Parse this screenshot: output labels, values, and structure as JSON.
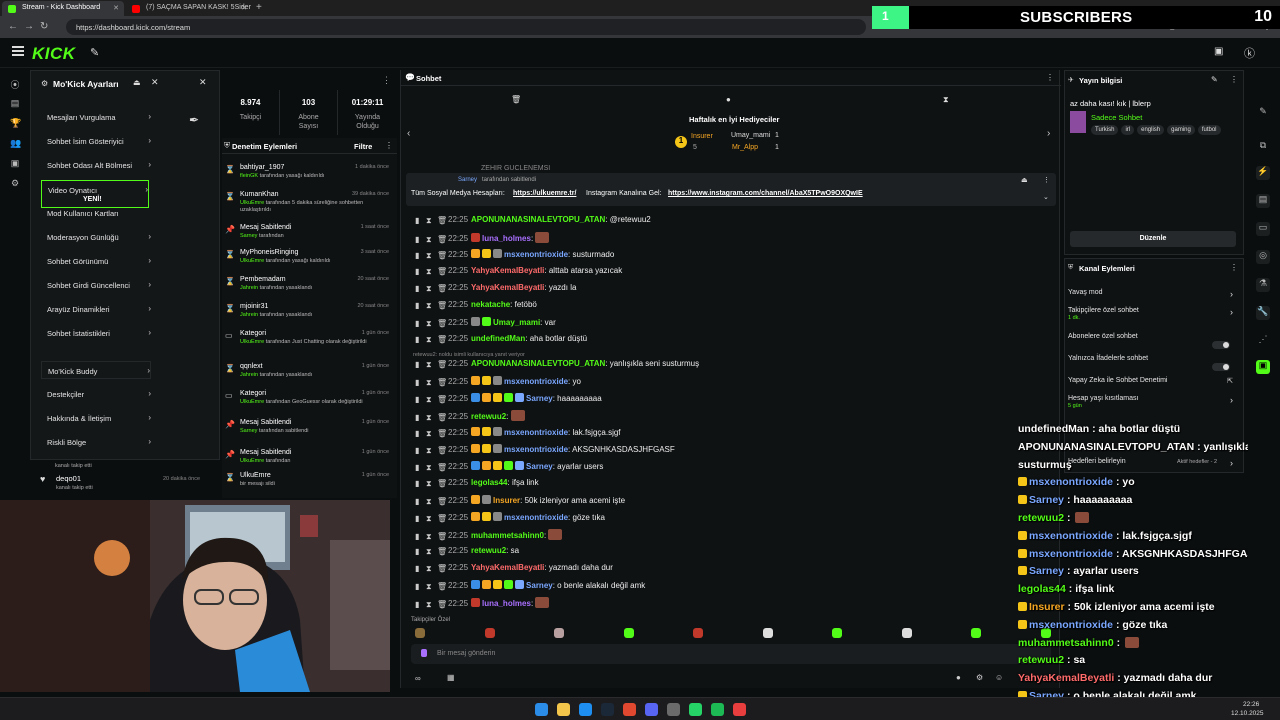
{
  "browser": {
    "tabs": [
      {
        "label": "Stream - Kick Dashboard",
        "active": true
      },
      {
        "label": "(7) SAÇMA SAPAN KASK! 5Sider",
        "active": false
      }
    ],
    "url": "https://dashboard.kick.com/stream"
  },
  "overlay_subs": {
    "value": "1",
    "title": "SUBSCRIBERS",
    "count": "10"
  },
  "kick": {
    "logo": "KICK"
  },
  "settings": {
    "title": "Mo'Kick Ayarları",
    "items": [
      {
        "label": "Mesajları Vurgulama"
      },
      {
        "label": "Sohbet İsim Gösteriyici"
      },
      {
        "label": "Sohbet Odası Alt Bölmesi"
      },
      {
        "label": "Video Oynatıcı"
      },
      {
        "label": "Mod Kullanıcı Kartları"
      },
      {
        "label": "Moderasyon Günlüğü"
      },
      {
        "label": "Sohbet Görünümü"
      },
      {
        "label": "Sohbet Girdi Güncellenci"
      },
      {
        "label": "Arayüz Dinamikleri"
      },
      {
        "label": "Sohbet İstatistikleri"
      },
      {
        "label": "Mo'Kick Buddy"
      },
      {
        "label": "Destekçiler"
      },
      {
        "label": "Hakkında & İletişim"
      },
      {
        "label": "Riskli Bölge"
      }
    ],
    "new_badge": "YENİ!"
  },
  "stats": [
    {
      "value": "8.974",
      "label": "Takipçi"
    },
    {
      "value": "103",
      "label": "Abone Sayısı"
    },
    {
      "value": "01:29:11",
      "label": "Yayında Olduğu"
    }
  ],
  "modlog": {
    "title": "Denetim Eylemleri",
    "filter": "Filtre",
    "entries": [
      {
        "name": "bahtiyar_1907",
        "time": "1 dakika önce",
        "desc1": "fleinGK",
        "desc2": "tarafından yasağı kaldırıldı"
      },
      {
        "name": "KumanKhan",
        "time": "39 dakika önce",
        "desc1": "UlkuEmre",
        "desc2": "tarafından 5 dakika süreliğine sohbetten uzaklaştırıldı"
      },
      {
        "name": "Mesaj Sabitlendi",
        "time": "1 saat önce",
        "desc1": "Sarney",
        "desc2": "tarafından"
      },
      {
        "name": "MyPhoneisRinging",
        "time": "3 saat önce",
        "desc1": "UlkuEmre",
        "desc2": "tarafından yasağı kaldırıldı"
      },
      {
        "name": "Pembemadam",
        "time": "20 saat önce",
        "desc1": "Jahrein",
        "desc2": "tarafından yasaklandı"
      },
      {
        "name": "mjoinir31",
        "time": "20 saat önce",
        "desc1": "Jahrein",
        "desc2": "tarafından yasaklandı"
      },
      {
        "name": "Kategori",
        "time": "1 gün önce",
        "desc1": "UlkuEmre",
        "desc2": "tarafından Just Chatting olarak değiştirildi"
      },
      {
        "name": "qqnlext",
        "time": "1 gün önce",
        "desc1": "Jahrein",
        "desc2": "tarafından yasaklandı"
      },
      {
        "name": "Kategori",
        "time": "1 gün önce",
        "desc1": "UlkuEmre",
        "desc2": "tarafından GeoGuessr olarak değiştirildi"
      },
      {
        "name": "Mesaj Sabitlendi",
        "time": "1 gün önce",
        "desc1": "Sarney",
        "desc2": "tarafından sabitlendi"
      },
      {
        "name": "Mesaj Sabitlendi",
        "time": "1 gün önce",
        "desc1": "UlkuEmre",
        "desc2": "tarafından"
      },
      {
        "name": "UlkuEmre",
        "time": "1 gün önce",
        "desc1": "",
        "desc2": "bir mesajı sildi"
      }
    ],
    "followers": [
      {
        "name": "deqo01",
        "time": "20 dakika önce",
        "desc": "kanalı takip etti"
      }
    ],
    "follow_prev": "kanalı takip etti",
    "ghost": "dakika önce"
  },
  "chat": {
    "title": "Sohbet",
    "gifters_title": "Haftalık en İyi Hediyeciler",
    "gifters": [
      {
        "name": "Insurer",
        "count": "5"
      },
      {
        "name": "Umay_mami",
        "count": "1"
      },
      {
        "name": "Mr_Alpp",
        "count": "1"
      }
    ],
    "pinned_by": "Sarney",
    "pinned_by_suffix": "tarafından sabitlendi",
    "pinned_text": "Tüm Sosyal Medya Hesapları:",
    "pinned_link1": "https://ulkuemre.tr/",
    "pinned_mid": "Instagram Kanalına Gel:",
    "pinned_link2": "https://www.instagram.com/channel/AbaX5TPwO9OXQwIE",
    "cut_line": "ZEHIR GUCLENEMSI",
    "reply_hint": "retewuu2: noldu isimli kullanıcıya yanıt veriyor",
    "messages": [
      {
        "time": "22:25",
        "user": "APONUNANASINALEVTOPU_ATAN",
        "color": "#53fc18",
        "msg": "@retewuu2"
      },
      {
        "time": "22:25",
        "user": "luna_holmes",
        "color": "#a970ff",
        "msg": ""
      },
      {
        "time": "22:25",
        "user": "msxenontrioxide",
        "color": "#7aa7ff",
        "msg": "susturmado"
      },
      {
        "time": "22:25",
        "user": "YahyaKemalBeyatli",
        "color": "#ff6b6b",
        "msg": "alttab atarsa yazıcak"
      },
      {
        "time": "22:25",
        "user": "YahyaKemalBeyatli",
        "color": "#ff6b6b",
        "msg": "yazdı la"
      },
      {
        "time": "22:25",
        "user": "nekatache",
        "color": "#53fc18",
        "msg": "fetöbö"
      },
      {
        "time": "22:25",
        "user": "Umay_mami",
        "color": "#53fc18",
        "msg": "var"
      },
      {
        "time": "22:25",
        "user": "undefinedMan",
        "color": "#53fc18",
        "msg": "aha botlar düştü"
      },
      {
        "time": "22:25",
        "user": "APONUNANASINALEVTOPU_ATAN",
        "color": "#53fc18",
        "msg": "yanlışıkla seni susturmuş"
      },
      {
        "time": "22:25",
        "user": "msxenontrioxide",
        "color": "#7aa7ff",
        "msg": "yo"
      },
      {
        "time": "22:25",
        "user": "Sarney",
        "color": "#7aa7ff",
        "msg": "haaaaaaaaa"
      },
      {
        "time": "22:25",
        "user": "retewuu2",
        "color": "#53fc18",
        "msg": ""
      },
      {
        "time": "22:25",
        "user": "msxenontrioxide",
        "color": "#7aa7ff",
        "msg": "lak.fsjgça.sjgf"
      },
      {
        "time": "22:25",
        "user": "msxenontrioxide",
        "color": "#7aa7ff",
        "msg": "AKSGNHKASDASJHFGASF"
      },
      {
        "time": "22:25",
        "user": "Sarney",
        "color": "#7aa7ff",
        "msg": "ayarlar users"
      },
      {
        "time": "22:25",
        "user": "legolas44",
        "color": "#53fc18",
        "msg": "ifşa link"
      },
      {
        "time": "22:25",
        "user": "Insurer",
        "color": "#f5a623",
        "msg": "50k izleniyor ama acemi işte"
      },
      {
        "time": "22:25",
        "user": "msxenontrioxide",
        "color": "#7aa7ff",
        "msg": "göze tıka"
      },
      {
        "time": "22:25",
        "user": "muhammetsahinn0",
        "color": "#53fc18",
        "msg": ""
      },
      {
        "time": "22:25",
        "user": "retewuu2",
        "color": "#53fc18",
        "msg": "sa"
      },
      {
        "time": "22:25",
        "user": "YahyaKemalBeyatli",
        "color": "#ff6b6b",
        "msg": "yazmadı daha dur"
      },
      {
        "time": "22:25",
        "user": "Sarney",
        "color": "#7aa7ff",
        "msg": "o benle alakalı değil amk"
      },
      {
        "time": "22:25",
        "user": "luna_holmes",
        "color": "#a970ff",
        "msg": ""
      }
    ],
    "followers_label": "Takipçiler Özel",
    "input_placeholder": "Bir mesaj gönderin"
  },
  "stream_info": {
    "title": "Yayın bilgisi",
    "stream_title": "az daha kası! kık | lblerp",
    "category": "Sadece Sohbet",
    "tags": [
      "Turkish",
      "irl",
      "english",
      "gaming",
      "futbol"
    ],
    "edit": "Düzenle"
  },
  "channel_actions": {
    "title": "Kanal Eylemleri",
    "items": [
      {
        "label": "Yavaş mod",
        "sub": ""
      },
      {
        "label": "Takipçilere özel sohbet",
        "sub": "1 dk."
      },
      {
        "label": "Abonelere özel sohbet",
        "sub": ""
      },
      {
        "label": "Yalnızca İfadelerle sohbet",
        "sub": ""
      },
      {
        "label": "Yapay Zeka ile Sohbet Denetimi",
        "sub": ""
      },
      {
        "label": "Hesap yaşı kısıtlaması",
        "sub": "5 gün"
      },
      {
        "label": "Hedefleri belirleyin",
        "sub": ""
      }
    ],
    "active_goals": "Aktif hedefler - 2"
  },
  "overlay_chat": [
    {
      "user": "undefinedMan",
      "msg": "aha botlar düştü",
      "color": "#ffffff"
    },
    {
      "user": "APONUNANASINALEVTOPU_ATAN",
      "msg": "yanlışıkla seni",
      "color": "#ffffff"
    },
    {
      "user": "",
      "msg": "susturmuş",
      "color": "#ffffff"
    },
    {
      "user": "msxenontrioxide",
      "msg": "yo",
      "color": "#7aa7ff"
    },
    {
      "user": "Sarney",
      "msg": "haaaaaaaaa",
      "color": "#7aa7ff"
    },
    {
      "user": "retewuu2",
      "msg": "",
      "color": "#53fc18"
    },
    {
      "user": "msxenontrioxide",
      "msg": "lak.fsjgça.sjgf",
      "color": "#7aa7ff"
    },
    {
      "user": "msxenontrioxide",
      "msg": "AKSGNHKASDASJHFGASF",
      "color": "#7aa7ff"
    },
    {
      "user": "Sarney",
      "msg": "ayarlar users",
      "color": "#7aa7ff"
    },
    {
      "user": "legolas44",
      "msg": "ifşa link",
      "color": "#53fc18"
    },
    {
      "user": "Insurer",
      "msg": "50k izleniyor ama acemi işte",
      "color": "#f5a623"
    },
    {
      "user": "msxenontrioxide",
      "msg": "göze tıka",
      "color": "#7aa7ff"
    },
    {
      "user": "muhammetsahinn0",
      "msg": "",
      "color": "#53fc18"
    },
    {
      "user": "retewuu2",
      "msg": "sa",
      "color": "#53fc18"
    },
    {
      "user": "YahyaKemalBeyatli",
      "msg": "yazmadı daha dur",
      "color": "#ff6b6b"
    },
    {
      "user": "Sarney",
      "msg": "o benle alakalı değil amk",
      "color": "#7aa7ff"
    },
    {
      "user": "luna_holmes",
      "msg": "",
      "color": "#a970ff"
    }
  ],
  "taskbar": {
    "time": "22:26",
    "date": "12.10.2025"
  },
  "colors": {
    "accent": "#53fc18",
    "bg": "#0b0e0f",
    "panel": "#0f1213"
  }
}
